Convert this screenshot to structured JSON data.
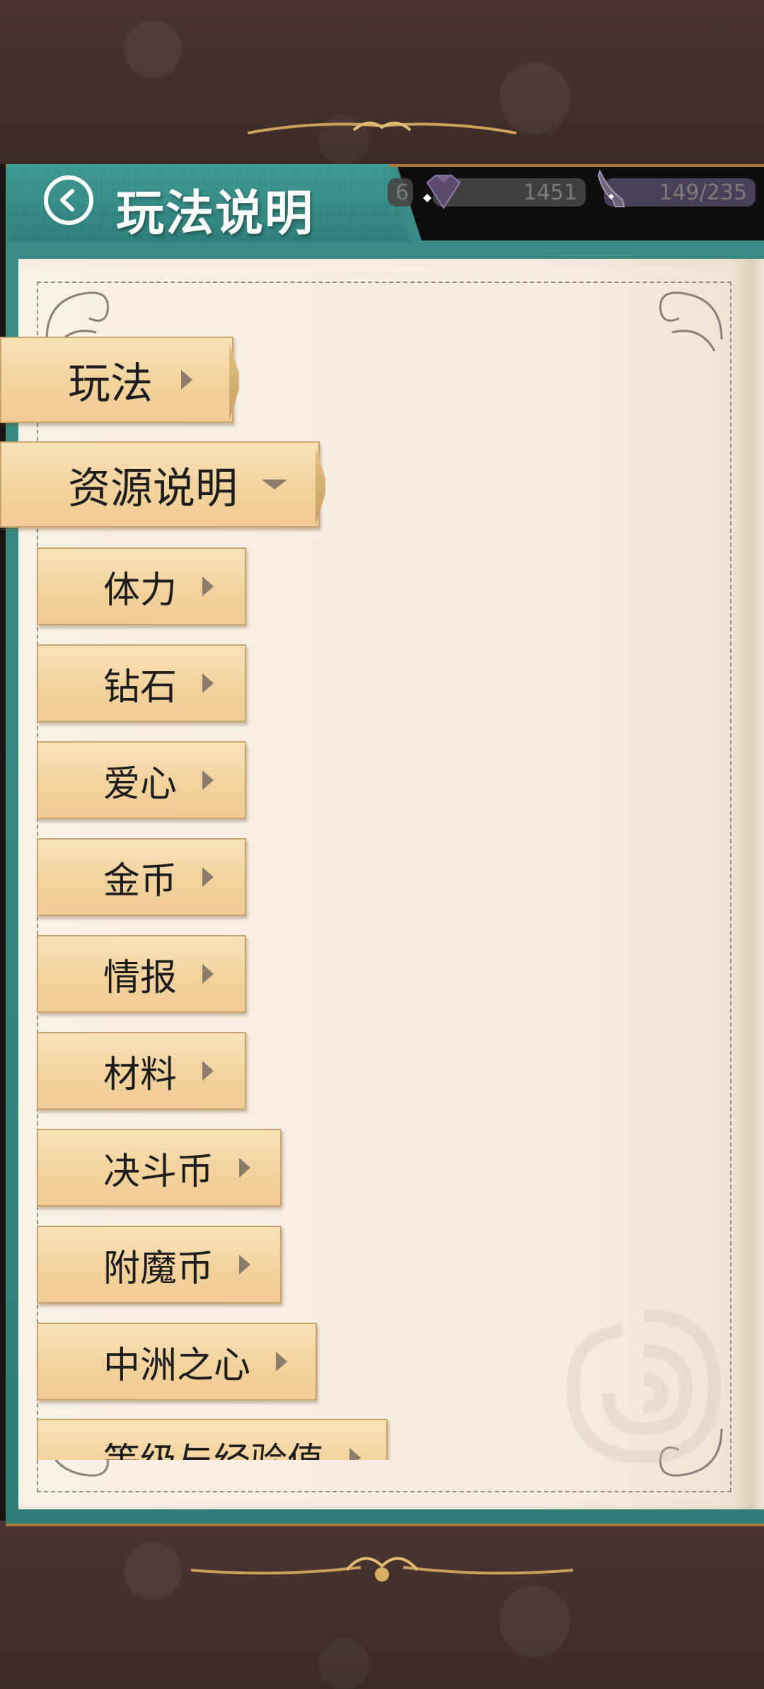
{
  "header": {
    "title": "玩法说明",
    "back_icon": "back-arrow-icon"
  },
  "currencies": [
    {
      "name": "partial",
      "value": "6"
    },
    {
      "name": "diamond",
      "value": "1451",
      "icon": "diamond-icon"
    },
    {
      "name": "stamina",
      "value": "149/235",
      "icon": "high-heel-icon"
    }
  ],
  "menu": {
    "main_tabs": [
      {
        "label": "玩法",
        "state": "collapsed"
      },
      {
        "label": "资源说明",
        "state": "expanded"
      }
    ],
    "sub_tabs": [
      {
        "label": "体力"
      },
      {
        "label": "钻石"
      },
      {
        "label": "爱心"
      },
      {
        "label": "金币"
      },
      {
        "label": "情报"
      },
      {
        "label": "材料"
      },
      {
        "label": "决斗币"
      },
      {
        "label": "附魔币"
      },
      {
        "label": "中洲之心"
      },
      {
        "label": "等级与经验值"
      }
    ]
  },
  "colors": {
    "teal": "#2f7d78",
    "parchment": "#f7eee2",
    "tab_gold": "#f3d29c",
    "gold_trim": "#a77a3b"
  }
}
